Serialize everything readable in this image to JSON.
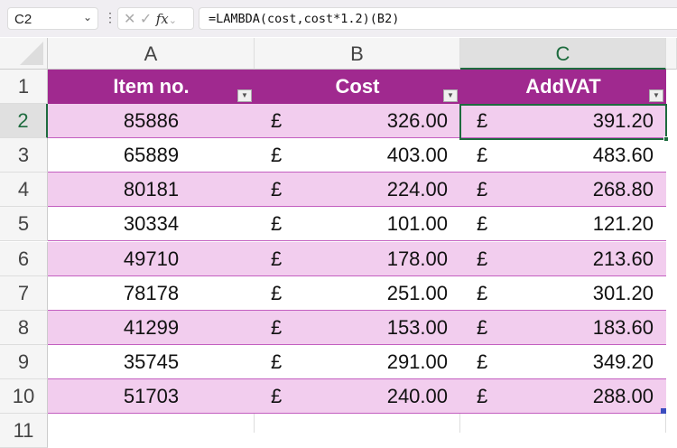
{
  "formula_bar": {
    "name_box": "C2",
    "formula": "=LAMBDA(cost,cost*1.2)(B2)",
    "fx": "fx",
    "cancel": "✕",
    "enter": "✓"
  },
  "columns": [
    "A",
    "B",
    "C"
  ],
  "rows": [
    "1",
    "2",
    "3",
    "4",
    "5",
    "6",
    "7",
    "8",
    "9",
    "10",
    "11"
  ],
  "headers": [
    "Item no.",
    "Cost",
    "AddVAT"
  ],
  "currency": "£",
  "data": [
    [
      "85886",
      "326.00",
      "391.20"
    ],
    [
      "65889",
      "403.00",
      "483.60"
    ],
    [
      "80181",
      "224.00",
      "268.80"
    ],
    [
      "30334",
      "101.00",
      "121.20"
    ],
    [
      "49710",
      "178.00",
      "213.60"
    ],
    [
      "78178",
      "251.00",
      "301.20"
    ],
    [
      "41299",
      "153.00",
      "183.60"
    ],
    [
      "35745",
      "291.00",
      "349.20"
    ],
    [
      "51703",
      "240.00",
      "288.00"
    ]
  ],
  "colors": {
    "header": "#a0298f",
    "band": "#f2cdee",
    "selection": "#1d6b3e"
  }
}
